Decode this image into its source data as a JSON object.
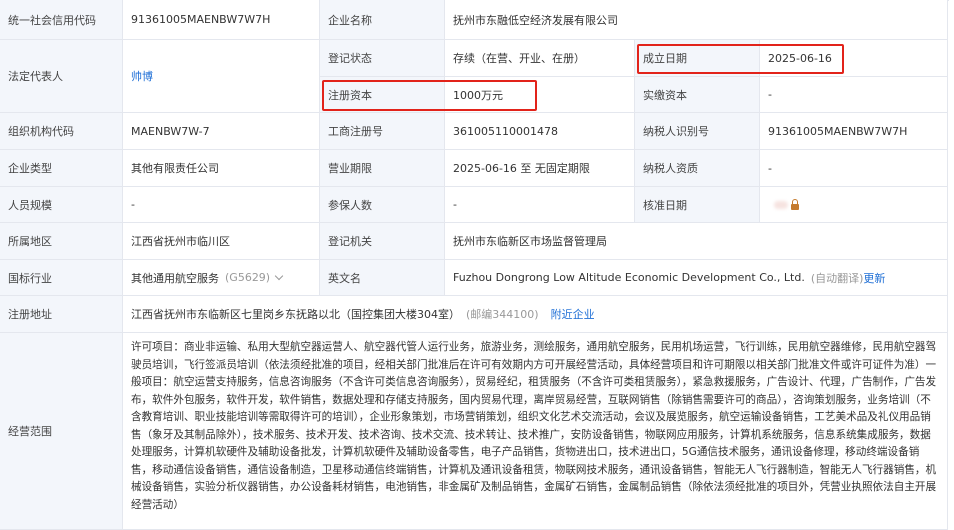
{
  "rows": {
    "credit_code": {
      "label": "统一社会信用代码",
      "value": "91361005MAENBW7W7H"
    },
    "company_name": {
      "label": "企业名称",
      "value": "抚州市东融低空经济发展有限公司"
    },
    "legal_rep": {
      "label": "法定代表人",
      "value": "帅博"
    },
    "reg_status": {
      "label": "登记状态",
      "value": "存续（在营、开业、在册）"
    },
    "founded": {
      "label": "成立日期",
      "value": "2025-06-16"
    },
    "reg_capital": {
      "label": "注册资本",
      "value": "1000万元"
    },
    "paid_capital": {
      "label": "实缴资本",
      "value": "-"
    },
    "org_code": {
      "label": "组织机构代码",
      "value": "MAENBW7W-7"
    },
    "biz_reg_no": {
      "label": "工商注册号",
      "value": "361005110001478"
    },
    "taxpayer_id": {
      "label": "纳税人识别号",
      "value": "91361005MAENBW7W7H"
    },
    "company_type": {
      "label": "企业类型",
      "value": "其他有限责任公司"
    },
    "biz_term": {
      "label": "营业期限",
      "value": "2025-06-16 至 无固定期限"
    },
    "taxpayer_qual": {
      "label": "纳税人资质",
      "value": "-"
    },
    "staff_size": {
      "label": "人员规模",
      "value": "-"
    },
    "insured": {
      "label": "参保人数",
      "value": "-"
    },
    "approval_date": {
      "label": "核准日期"
    },
    "region": {
      "label": "所属地区",
      "value": "江西省抚州市临川区"
    },
    "reg_authority": {
      "label": "登记机关",
      "value": "抚州市东临新区市场监督管理局"
    },
    "industry": {
      "label": "国标行业",
      "value": "其他通用航空服务",
      "code": "(G5629)"
    },
    "english_name": {
      "label": "英文名",
      "value": "Fuzhou Dongrong Low Altitude Economic Development Co., Ltd.",
      "auto_translate": "(自动翻译)",
      "update_link": "更新"
    },
    "address": {
      "label": "注册地址",
      "value": "江西省抚州市东临新区七里岗乡东抚路以北（国控集团大楼304室）",
      "postcode": "(邮编344100)",
      "nearby_link": "附近企业"
    },
    "scope": {
      "label": "经营范围",
      "value": "许可项目：商业非运输、私用大型航空器运营人、航空器代管人运行业务，旅游业务，测绘服务，通用航空服务，民用机场运营，飞行训练，民用航空器维修，民用航空器驾驶员培训，飞行签派员培训（依法须经批准的项目，经相关部门批准后在许可有效期内方可开展经营活动，具体经营项目和许可期限以相关部门批准文件或许可证件为准）一般项目：航空运营支持服务，信息咨询服务（不含许可类信息咨询服务），贸易经纪，租赁服务（不含许可类租赁服务），紧急救援服务，广告设计、代理，广告制作，广告发布，软件外包服务，软件开发，软件销售，数据处理和存储支持服务，国内贸易代理，离岸贸易经营，互联网销售（除销售需要许可的商品），咨询策划服务，业务培训（不含教育培训、职业技能培训等需取得许可的培训），企业形象策划，市场营销策划，组织文化艺术交流活动，会议及展览服务，航空运输设备销售，工艺美术品及礼仪用品销售（象牙及其制品除外），技术服务、技术开发、技术咨询、技术交流、技术转让、技术推广，安防设备销售，物联网应用服务，计算机系统服务，信息系统集成服务，数据处理服务，计算机软硬件及辅助设备批发，计算机软硬件及辅助设备零售，电子产品销售，货物进出口，技术进出口，5G通信技术服务，通讯设备修理，移动终端设备销售，移动通信设备销售，通信设备制造，卫星移动通信终端销售，计算机及通讯设备租赁，物联网技术服务，通讯设备销售，智能无人飞行器制造，智能无人飞行器销售，机械设备销售，实验分析仪器销售，办公设备耗材销售，电池销售，非金属矿及制品销售，金属矿石销售，金属制品销售（除依法须经批准的项目外，凭营业执照依法自主开展经营活动）"
    }
  },
  "highlight_color": "#e2231a",
  "icons": {
    "approval_date_hidden": "lock-icon",
    "industry_expand": "chevron-down-icon"
  }
}
